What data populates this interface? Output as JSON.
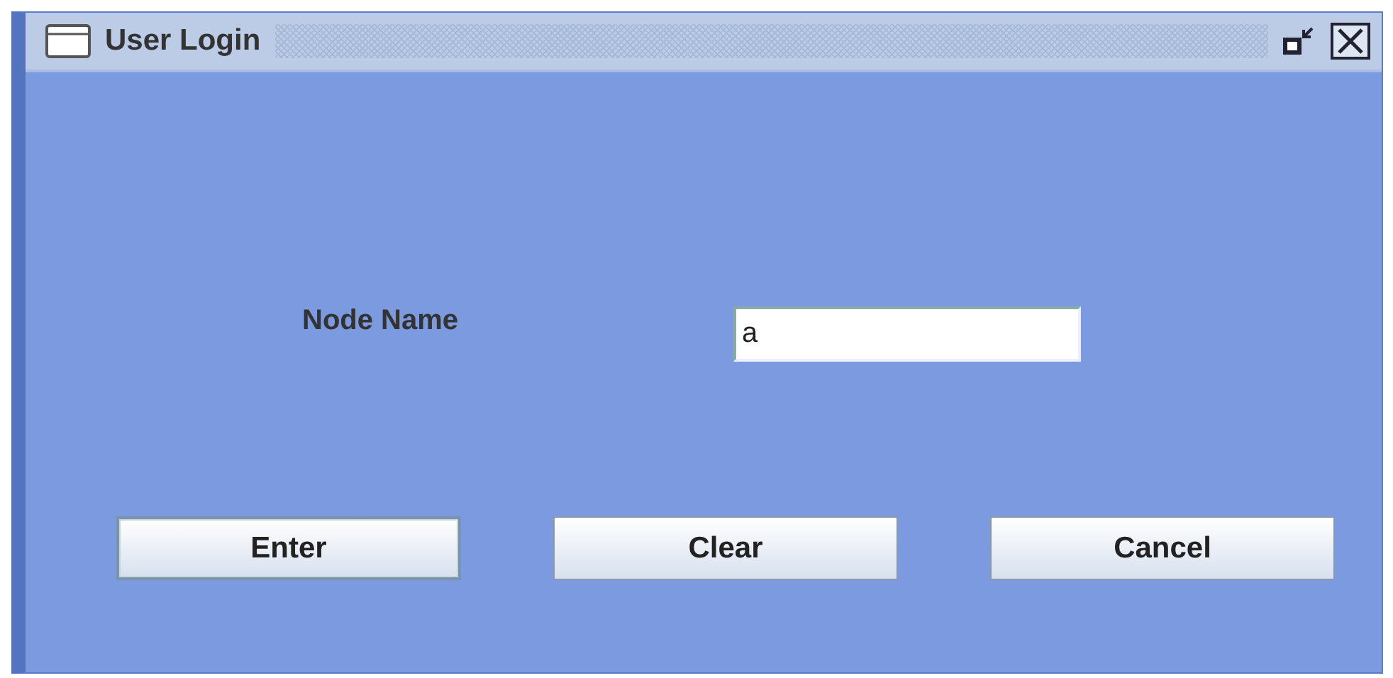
{
  "window": {
    "title": "User Login"
  },
  "form": {
    "label": "Node Name",
    "value": "a"
  },
  "buttons": [
    {
      "label": "Enter",
      "focused": true
    },
    {
      "label": "Clear",
      "focused": false
    },
    {
      "label": "Cancel",
      "focused": false
    }
  ]
}
